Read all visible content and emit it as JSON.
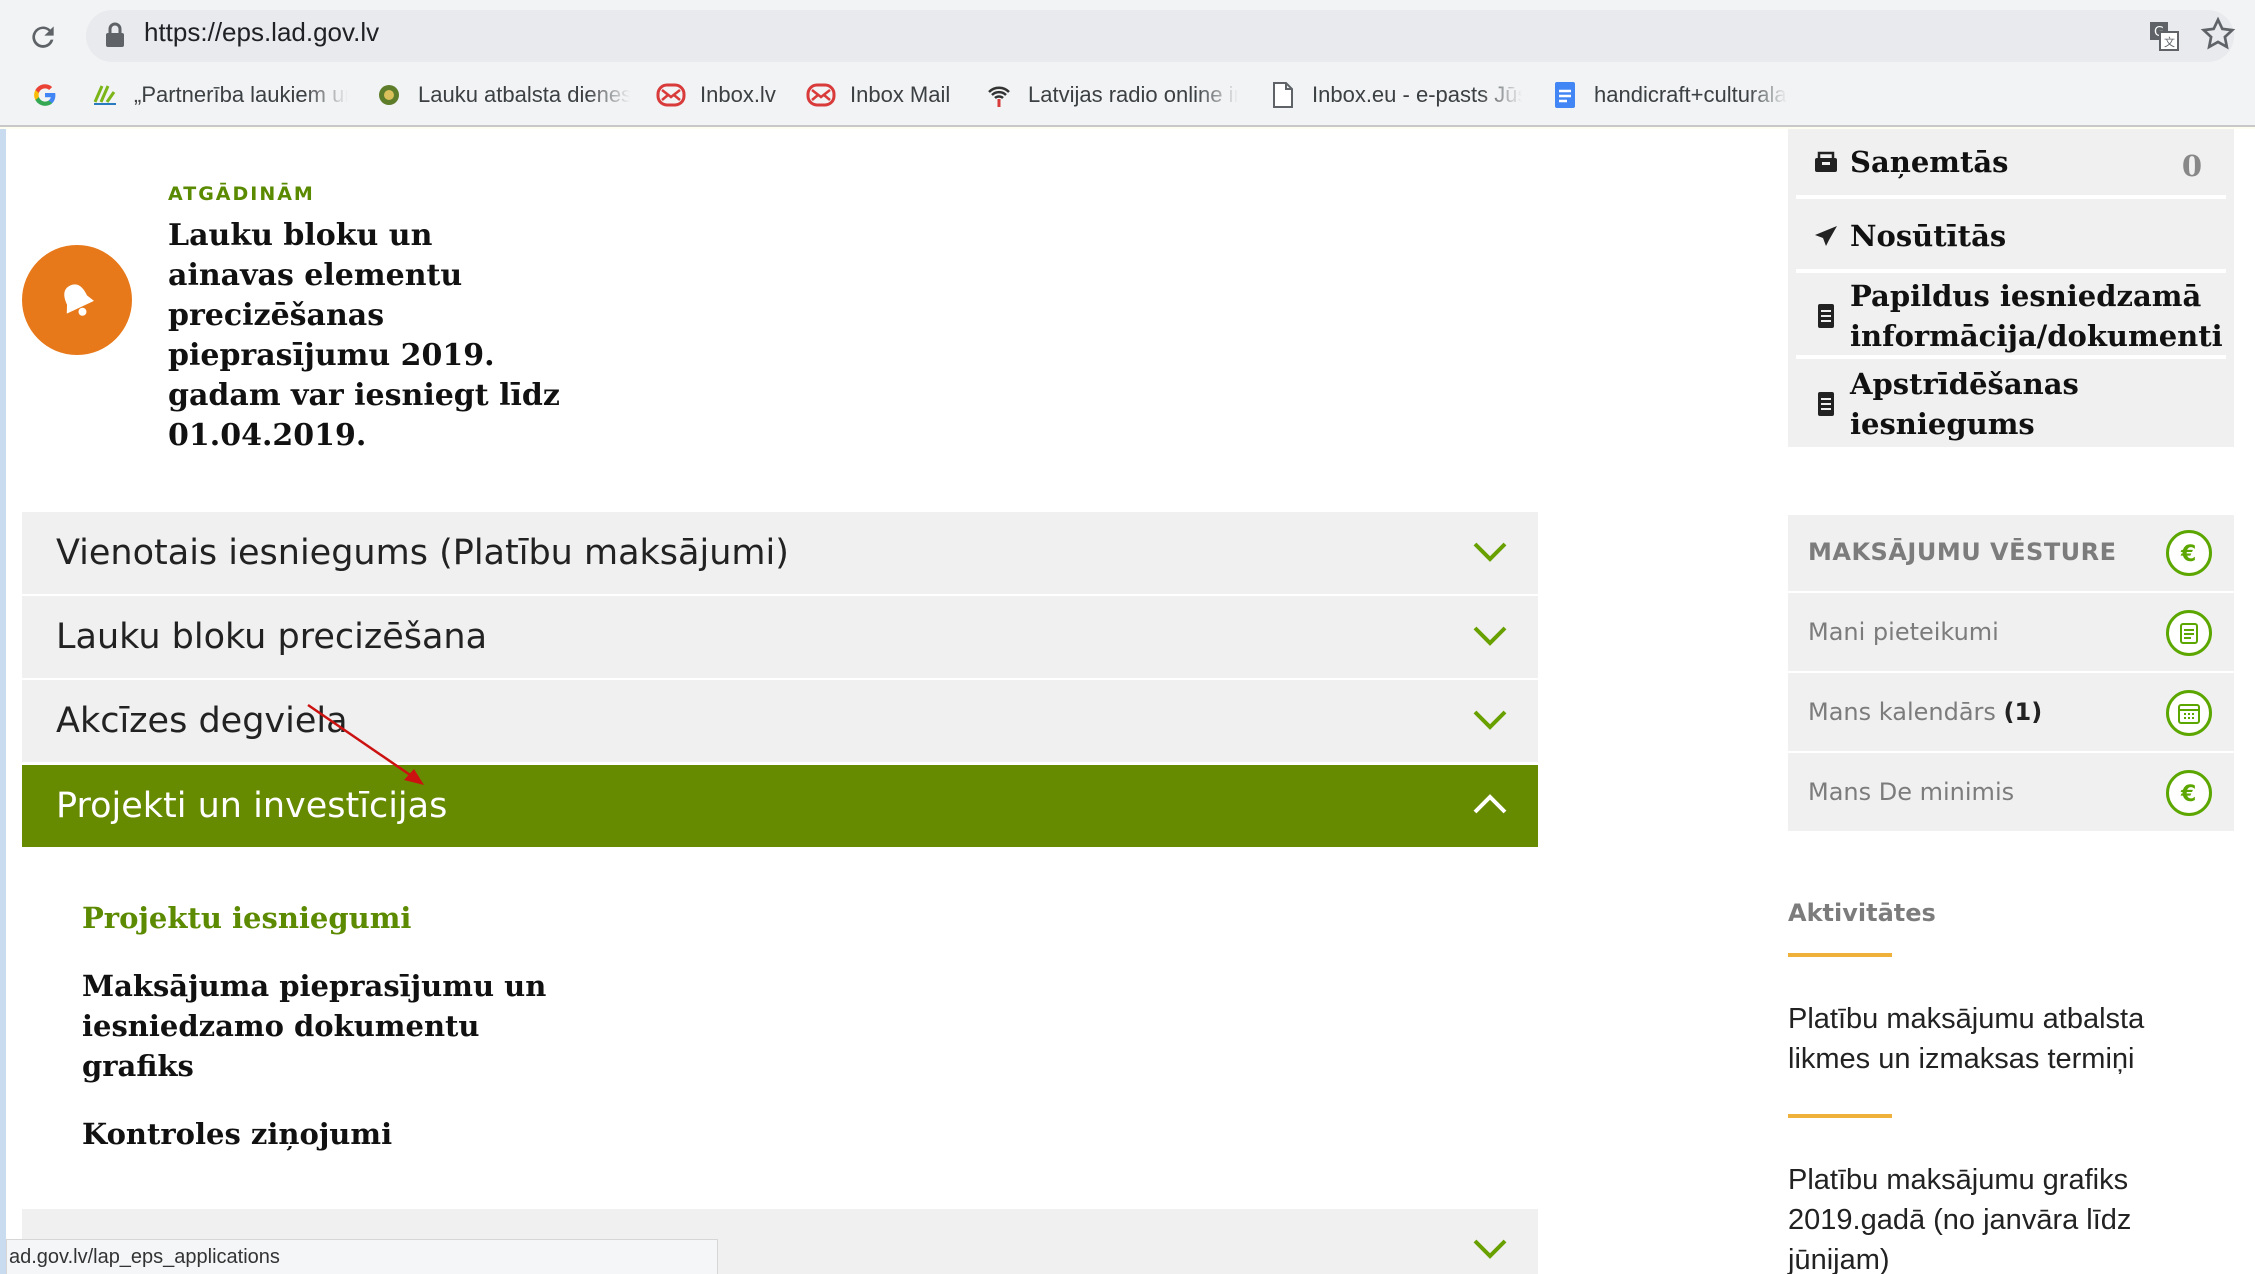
{
  "browser": {
    "url": "https://eps.lad.gov.lv",
    "bookmarks": [
      {
        "label": "„Partnerība laukiem un",
        "icon": "partnership-logo-icon"
      },
      {
        "label": "Lauku atbalsta dienests",
        "icon": "lad-logo-icon"
      },
      {
        "label": "Inbox.lv",
        "icon": "envelope-icon"
      },
      {
        "label": "Inbox Mail",
        "icon": "envelope-icon"
      },
      {
        "label": "Latvijas radio online in",
        "icon": "radio-icon"
      },
      {
        "label": "Inbox.eu - e-pasts Jūsu",
        "icon": "page-icon"
      },
      {
        "label": "handicraft+culturala",
        "icon": "docs-icon"
      }
    ],
    "status_url": "ad.gov.lv/lap_eps_applications"
  },
  "reminder": {
    "label": "ATGĀDINĀM",
    "text": "Lauku bloku un ainavas elementu precizēšanas pieprasījumu 2019. gadam var iesniegt līdz 01.04.2019."
  },
  "accordion": [
    {
      "label": "Vienotais iesniegums (Platību maksājumi)",
      "expanded": false
    },
    {
      "label": "Lauku bloku precizēšana",
      "expanded": false
    },
    {
      "label": "Akcīzes degviela",
      "expanded": false
    },
    {
      "label": "Projekti un investīcijas",
      "expanded": true
    }
  ],
  "projects_links": [
    "Projektu iesniegumi",
    "Maksājuma pieprasījumu un iesniedzamo dokumentu grafiks",
    "Kontroles ziņojumi"
  ],
  "messages": {
    "inbox_label": "Saņemtās",
    "inbox_count": "0",
    "sent_label": "Nosūtītās",
    "additional_label": "Papildus iesniedzamā informācija/dokumenti",
    "appeal_label": "Apstrīdēšanas iesniegums"
  },
  "quick_links": {
    "payment_history": "MAKSĀJUMU VĒSTURE",
    "my_applications": "Mani pieteikumi",
    "my_calendar": "Mans kalendārs",
    "my_calendar_count": "(1)",
    "my_de_minimis": "Mans De minimis"
  },
  "activities": {
    "title": "Aktivitātes",
    "items": [
      "Platību maksājumu atbalsta likmes un izmaksas termiņi",
      "Platību maksājumu grafiks 2019.gadā (no janvāra līdz jūnijam)"
    ]
  },
  "colors": {
    "brand_green": "#668a00",
    "icon_green": "#5ca600",
    "bell_orange": "#e8791a",
    "accent_yellow": "#f0b13a"
  }
}
